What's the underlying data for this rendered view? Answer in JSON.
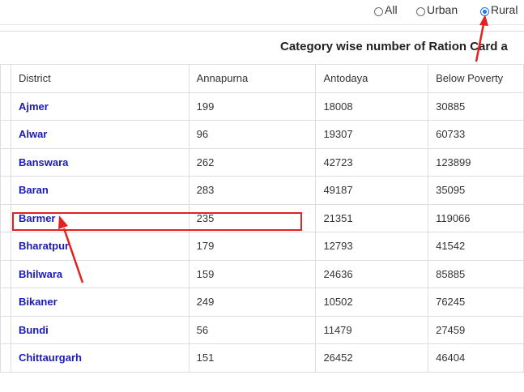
{
  "filters": {
    "all_label": "All",
    "urban_label": "Urban",
    "rural_label": "Rural",
    "selected": "Rural"
  },
  "title": "Category wise number of Ration Card a",
  "table": {
    "headers": [
      "District",
      "Annapurna",
      "Antodaya",
      "Below Poverty"
    ],
    "rows": [
      {
        "district": "Ajmer",
        "annapurna": "199",
        "antodaya": "18008",
        "bpl": "30885"
      },
      {
        "district": "Alwar",
        "annapurna": "96",
        "antodaya": "19307",
        "bpl": "60733"
      },
      {
        "district": "Banswara",
        "annapurna": "262",
        "antodaya": "42723",
        "bpl": "123899"
      },
      {
        "district": "Baran",
        "annapurna": "283",
        "antodaya": "49187",
        "bpl": "35095"
      },
      {
        "district": "Barmer",
        "annapurna": "235",
        "antodaya": "21351",
        "bpl": "119066"
      },
      {
        "district": "Bharatpur",
        "annapurna": "179",
        "antodaya": "12793",
        "bpl": "41542"
      },
      {
        "district": "Bhilwara",
        "annapurna": "159",
        "antodaya": "24636",
        "bpl": "85885"
      },
      {
        "district": "Bikaner",
        "annapurna": "249",
        "antodaya": "10502",
        "bpl": "76245"
      },
      {
        "district": "Bundi",
        "annapurna": "56",
        "antodaya": "11479",
        "bpl": "27459"
      },
      {
        "district": "Chittaurgarh",
        "annapurna": "151",
        "antodaya": "26452",
        "bpl": "46404"
      }
    ]
  },
  "annotation_color": "#e52020",
  "link_color": "#1a1ab8"
}
